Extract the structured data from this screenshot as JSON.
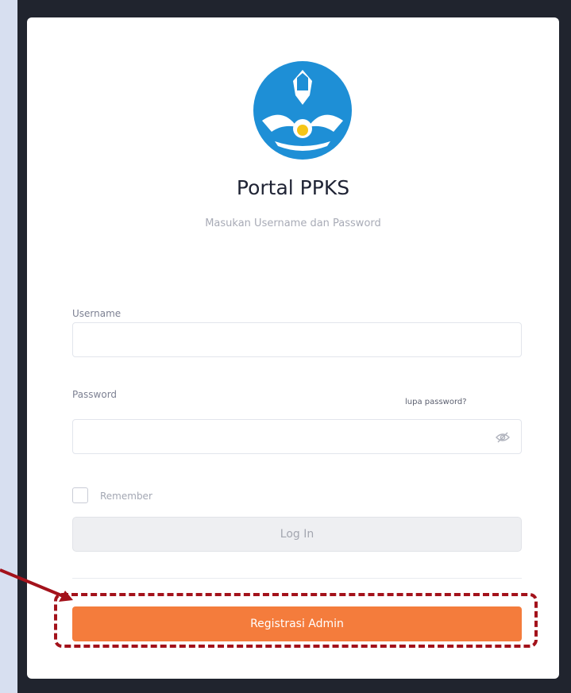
{
  "login_card": {
    "title": "Portal PPKS",
    "subtitle": "Masukan Username dan Password",
    "username": {
      "label": "Username",
      "value": "",
      "placeholder": ""
    },
    "password": {
      "label": "Password",
      "value": "",
      "placeholder": "",
      "forgot_link": "lupa password?"
    },
    "remember": {
      "label": "Remember",
      "checked": false
    },
    "login_button": "Log In",
    "register_button": "Registrasi Admin"
  },
  "colors": {
    "accent": "#f47c3c",
    "highlight": "#a3121b",
    "logo_blue": "#1e8fd6",
    "logo_yellow": "#f5c518",
    "background": "#d7dff0",
    "frame": "#20242e"
  },
  "icons": {
    "logo": "tut-wuri-handayani-emblem",
    "password_toggle": "eye-slash-icon"
  }
}
